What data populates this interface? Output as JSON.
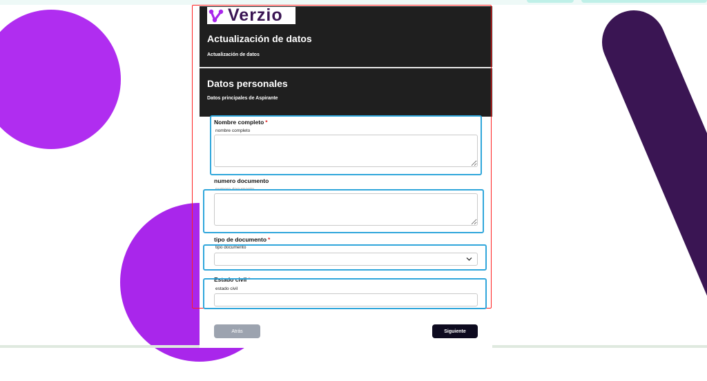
{
  "brand": {
    "name": "Verzio",
    "accent": "#3a1553",
    "icon_color": "#a926eb"
  },
  "header": {
    "title": "Actualización de datos",
    "subtitle": "Actualización de datos"
  },
  "section": {
    "title": "Datos personales",
    "subtitle": "Datos principales de Aspirante"
  },
  "fields": {
    "full_name": {
      "label": "Nombre completo",
      "required": "*",
      "help": "nombre completo",
      "value": ""
    },
    "doc_number": {
      "label": "numero documento",
      "help": "numero documento",
      "value": ""
    },
    "doc_type": {
      "label": "tipo de documento",
      "required": "*",
      "help": "tipo documento",
      "value": ""
    },
    "marital_status": {
      "label": "Estado civil",
      "required": "*",
      "help": "estado civil",
      "value": ""
    }
  },
  "nav": {
    "prev_label": "Atrás",
    "next_label": "Siguiente"
  },
  "colors": {
    "header_bg": "#1f1f1f",
    "required": "#e02424",
    "next_button": "#0d0a1f",
    "prev_button": "#9ca3af",
    "highlight_red": "#ff2020",
    "highlight_blue": "#2fa6db"
  }
}
